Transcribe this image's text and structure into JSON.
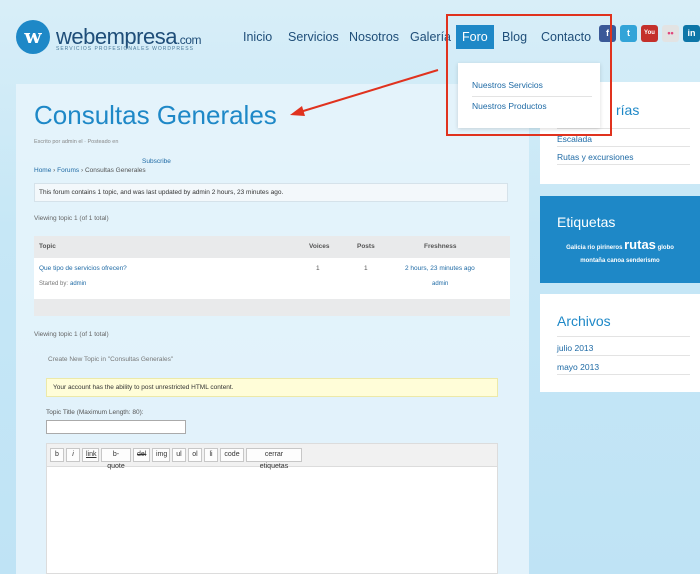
{
  "header": {
    "brand": "webempresa",
    "brand_suffix": ".com",
    "tagline": "SERVICIOS PROFESIONALES WORDPRESS",
    "logo_letter": "w"
  },
  "nav": {
    "items": [
      "Inicio",
      "Servicios",
      "Nosotros",
      "Galería",
      "Foro",
      "Blog",
      "Contacto"
    ],
    "active": "Foro"
  },
  "social": [
    {
      "icon": "facebook-icon",
      "glyph": "f",
      "color": "#3b5998"
    },
    {
      "icon": "twitter-icon",
      "glyph": "t",
      "color": "#33a4d8"
    },
    {
      "icon": "youtube-icon",
      "glyph": "You",
      "color": "#c4302b"
    },
    {
      "icon": "flickr-icon",
      "glyph": "••",
      "color": "#e3e3e3"
    },
    {
      "icon": "linkedin-icon",
      "glyph": "in",
      "color": "#0e76a8"
    }
  ],
  "dropdown": {
    "items": [
      "Nuestros Servicios",
      "Nuestros Productos"
    ]
  },
  "page": {
    "title": "Consultas Generales",
    "meta": "Escrito por admin el · Posteado en",
    "breadcrumb": [
      "Home",
      "Forums",
      "Consultas Generales"
    ],
    "subscribe": "Subscribe",
    "info": "This forum contains 1 topic, and was last updated by  admin 2 hours, 23 minutes ago.",
    "viewing_top": "Viewing topic 1 (of 1 total)",
    "viewing_bottom": "Viewing topic 1 (of 1 total)"
  },
  "table": {
    "headers": {
      "topic": "Topic",
      "voices": "Voices",
      "posts": "Posts",
      "freshness": "Freshness"
    },
    "rows": [
      {
        "title": "Que tipo de servicios ofrecen?",
        "started_label": "Started by:",
        "author": "admin",
        "voices": "1",
        "posts": "1",
        "freshness": "2 hours, 23 minutes ago",
        "last_author": "admin"
      }
    ]
  },
  "new_topic": {
    "legend": "Create New Topic in \"Consultas Generales\"",
    "notice": "Your account has the ability to post unrestricted HTML content.",
    "title_label": "Topic Title (Maximum Length: 80):",
    "toolbar": [
      "b",
      "i",
      "link",
      "b-quote",
      "del",
      "img",
      "ul",
      "ol",
      "li",
      "code",
      "cerrar etiquetas"
    ]
  },
  "sidebar": {
    "categories": {
      "title_partial": "rías",
      "items": [
        "Escalada",
        "Rutas y excursiones"
      ]
    },
    "tags": {
      "title": "Etiquetas",
      "words": [
        "Galicia",
        "rio",
        "pirineros",
        "rutas",
        "globo",
        "montaña",
        "canoa",
        "senderismo"
      ]
    },
    "archives": {
      "title": "Archivos",
      "items": [
        "julio 2013",
        "mayo 2013"
      ]
    }
  },
  "colors": {
    "accent": "#1e88c7",
    "annotation": "#e0321e"
  }
}
